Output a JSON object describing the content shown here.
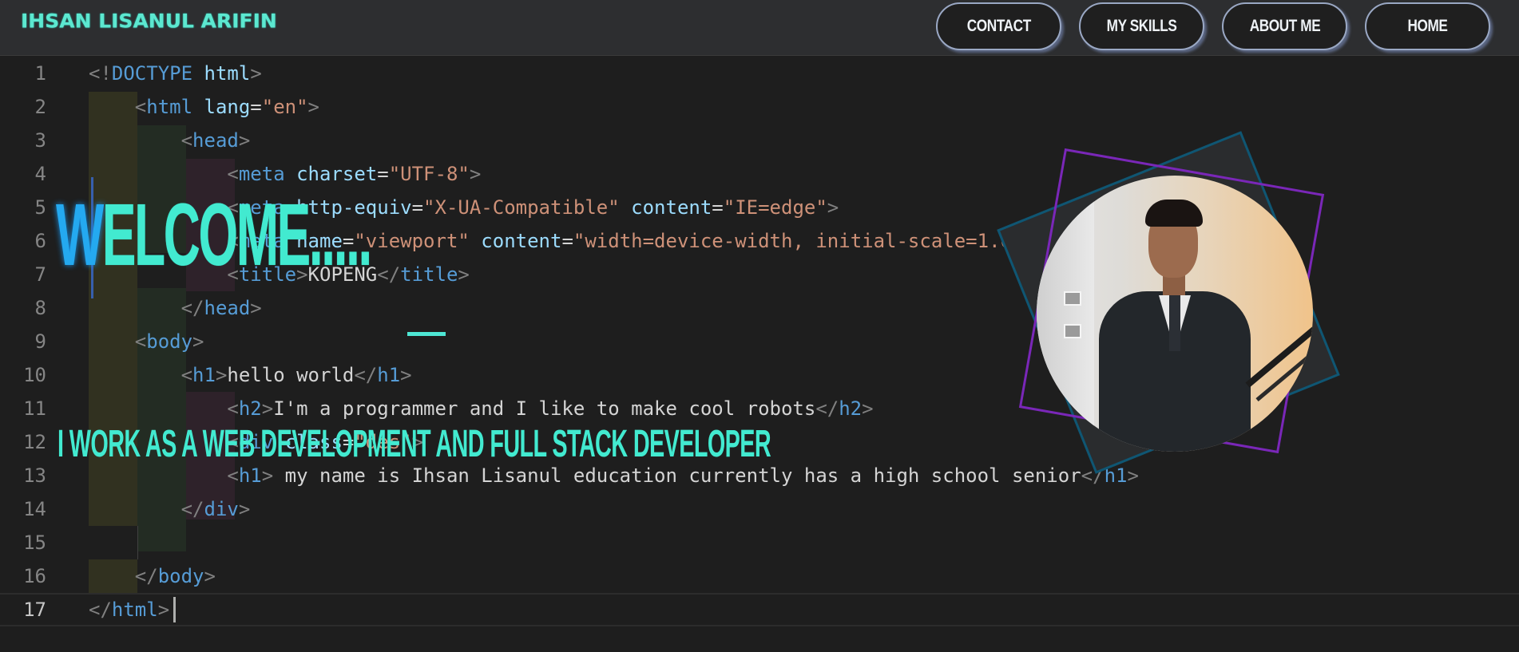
{
  "brand": {
    "name": "IHSAN LISANUL ARIFIN"
  },
  "nav": {
    "items": [
      {
        "label": "HOME"
      },
      {
        "label": "ABOUT ME"
      },
      {
        "label": "MY SKILLS"
      },
      {
        "label": "CONTACT"
      }
    ]
  },
  "editor": {
    "lines": [
      {
        "n": "1",
        "html": "<span class='t'>&lt;!</span><span class='k'>DOCTYPE</span> <span class='a'>html</span><span class='t'>&gt;</span>"
      },
      {
        "n": "2",
        "html": "    <span class='t'>&lt;</span><span class='k'>html</span> <span class='a'>lang</span>=<span class='s'>\"en\"</span><span class='t'>&gt;</span>"
      },
      {
        "n": "3",
        "html": "        <span class='t'>&lt;</span><span class='k'>head</span><span class='t'>&gt;</span>"
      },
      {
        "n": "4",
        "html": "            <span class='t'>&lt;</span><span class='k'>meta</span> <span class='a'>charset</span>=<span class='s'>\"UTF-8\"</span><span class='t'>&gt;</span>"
      },
      {
        "n": "5",
        "html": "            <span class='t'>&lt;</span><span class='k'>meta</span> <span class='a'>http-equiv</span>=<span class='s'>\"X-UA-Compatible\"</span> <span class='a'>content</span>=<span class='s'>\"IE=edge\"</span><span class='t'>&gt;</span>"
      },
      {
        "n": "6",
        "html": "            <span class='t'>&lt;</span><span class='k'>meta</span> <span class='a'>name</span>=<span class='s'>\"viewport\"</span> <span class='a'>content</span>=<span class='s'>\"width=device-width, initial-scale=1.0\"</span><span class='t'>&gt;</span>"
      },
      {
        "n": "7",
        "html": "            <span class='t'>&lt;</span><span class='k'>title</span><span class='t'>&gt;</span>KOPENG<span class='t'>&lt;/</span><span class='k'>title</span><span class='t'>&gt;</span>"
      },
      {
        "n": "8",
        "html": "        <span class='t'>&lt;/</span><span class='k'>head</span><span class='t'>&gt;</span>"
      },
      {
        "n": "9",
        "html": "    <span class='t'>&lt;</span><span class='k'>body</span><span class='t'>&gt;</span>"
      },
      {
        "n": "10",
        "html": "        <span class='t'>&lt;</span><span class='k'>h1</span><span class='t'>&gt;</span>hello world<span class='t'>&lt;/</span><span class='k'>h1</span><span class='t'>&gt;</span>"
      },
      {
        "n": "11",
        "html": "            <span class='t'>&lt;</span><span class='k'>h2</span><span class='t'>&gt;</span>I'm a programmer and I like to make cool robots<span class='t'>&lt;/</span><span class='k'>h2</span><span class='t'>&gt;</span>"
      },
      {
        "n": "12",
        "html": "            <span class='t'>&lt;</span><span class='k'>div</span> <span class='a'>class</span>=<span class='s'>\"des\"</span><span class='t'>&gt;</span>"
      },
      {
        "n": "13",
        "html": "            <span class='t'>&lt;</span><span class='k'>h1</span><span class='t'>&gt;</span> my name is Ihsan Lisanul education currently has a high school senior<span class='t'>&lt;/</span><span class='k'>h1</span><span class='t'>&gt;</span>"
      },
      {
        "n": "14",
        "html": "        <span class='t'>&lt;/</span><span class='k'>div</span><span class='t'>&gt;</span>"
      },
      {
        "n": "15",
        "html": ""
      },
      {
        "n": "16",
        "html": "    <span class='t'>&lt;/</span><span class='k'>body</span><span class='t'>&gt;</span>"
      },
      {
        "n": "17",
        "html": "<span class='t'>&lt;/</span><span class='k'>html</span><span class='t'>&gt;</span>"
      }
    ]
  },
  "hero": {
    "welcome_first": "W",
    "welcome_rest": "ELCOME.....",
    "subtitle": "I WORK AS A WEB DEVELOPMENT AND FULL STACK DEVELOPER"
  },
  "colors": {
    "accent": "#42ead0",
    "welcome_w": "#24a9f0",
    "frame_purple": "#7a27b8",
    "frame_teal": "#0f5673"
  }
}
